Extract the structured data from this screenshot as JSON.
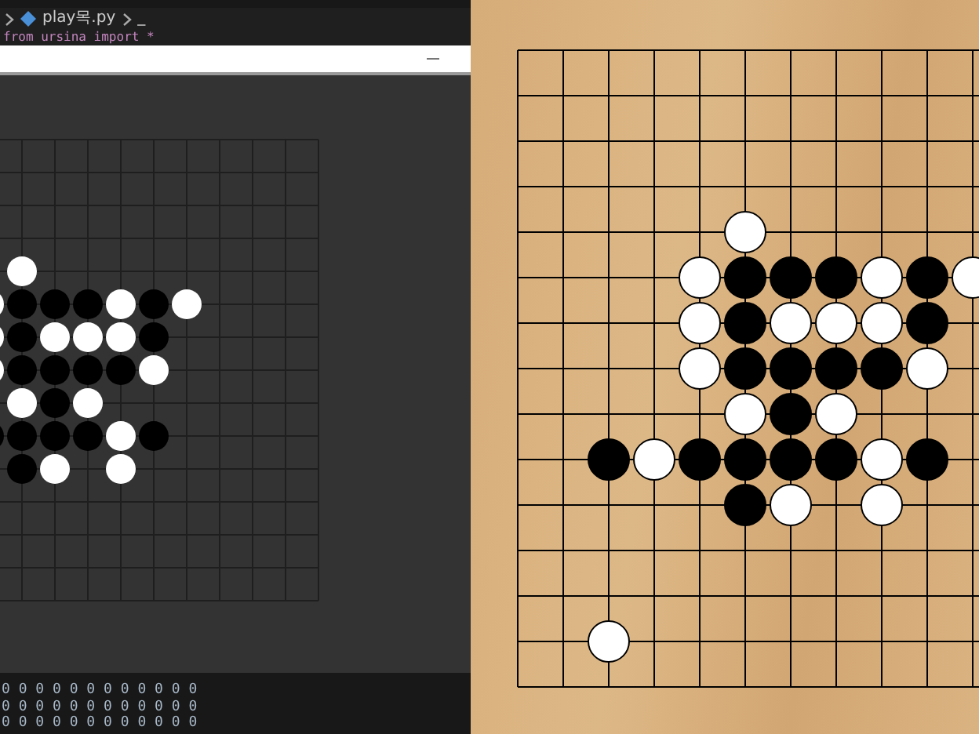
{
  "editor": {
    "file": "play목.py",
    "symbol": "_",
    "code_line": "from ursina import *"
  },
  "board": {
    "rows": [
      [
        {
          "kind": "empty"
        },
        {
          "kind": "empty"
        },
        {
          "kind": "empty"
        },
        {
          "kind": "empty"
        },
        {
          "kind": "empty"
        },
        {
          "kind": "empty"
        },
        {
          "kind": "empty"
        },
        {
          "kind": "empty"
        },
        {
          "kind": "empty"
        },
        {
          "kind": "empty"
        },
        {
          "kind": "empty"
        },
        {
          "kind": "empty"
        },
        {
          "kind": "empty"
        },
        {
          "kind": "empty"
        },
        {
          "kind": "empty"
        }
      ],
      [
        {
          "kind": "empty"
        },
        {
          "kind": "empty"
        },
        {
          "kind": "empty"
        },
        {
          "kind": "empty"
        },
        {
          "kind": "empty"
        },
        {
          "kind": "empty"
        },
        {
          "kind": "empty"
        },
        {
          "kind": "empty"
        },
        {
          "kind": "empty"
        },
        {
          "kind": "empty"
        },
        {
          "kind": "empty"
        },
        {
          "kind": "empty"
        },
        {
          "kind": "empty"
        },
        {
          "kind": "empty"
        },
        {
          "kind": "empty"
        }
      ],
      [
        {
          "kind": "empty"
        },
        {
          "kind": "empty"
        },
        {
          "kind": "empty"
        },
        {
          "kind": "empty"
        },
        {
          "kind": "empty"
        },
        {
          "kind": "empty"
        },
        {
          "kind": "empty"
        },
        {
          "kind": "empty"
        },
        {
          "kind": "empty"
        },
        {
          "kind": "empty"
        },
        {
          "kind": "empty"
        },
        {
          "kind": "empty"
        },
        {
          "kind": "empty"
        },
        {
          "kind": "empty"
        },
        {
          "kind": "empty"
        }
      ],
      [
        {
          "kind": "empty"
        },
        {
          "kind": "empty"
        },
        {
          "kind": "empty"
        },
        {
          "kind": "empty"
        },
        {
          "kind": "empty"
        },
        {
          "kind": "empty"
        },
        {
          "kind": "empty"
        },
        {
          "kind": "empty"
        },
        {
          "kind": "empty"
        },
        {
          "kind": "empty"
        },
        {
          "kind": "empty"
        },
        {
          "kind": "empty"
        },
        {
          "kind": "empty"
        },
        {
          "kind": "empty"
        },
        {
          "kind": "empty"
        }
      ],
      [
        {
          "kind": "empty"
        },
        {
          "kind": "empty"
        },
        {
          "kind": "empty"
        },
        {
          "kind": "empty"
        },
        {
          "kind": "empty"
        },
        {
          "kind": "white"
        },
        {
          "kind": "empty"
        },
        {
          "kind": "empty"
        },
        {
          "kind": "empty"
        },
        {
          "kind": "empty"
        },
        {
          "kind": "empty"
        },
        {
          "kind": "empty"
        },
        {
          "kind": "empty"
        },
        {
          "kind": "empty"
        },
        {
          "kind": "empty"
        }
      ],
      [
        {
          "kind": "empty"
        },
        {
          "kind": "empty"
        },
        {
          "kind": "empty"
        },
        {
          "kind": "empty"
        },
        {
          "kind": "white"
        },
        {
          "kind": "black"
        },
        {
          "kind": "black"
        },
        {
          "kind": "black"
        },
        {
          "kind": "white"
        },
        {
          "kind": "black"
        },
        {
          "kind": "white"
        },
        {
          "kind": "empty"
        },
        {
          "kind": "empty"
        },
        {
          "kind": "empty"
        },
        {
          "kind": "empty"
        }
      ],
      [
        {
          "kind": "empty"
        },
        {
          "kind": "empty"
        },
        {
          "kind": "empty"
        },
        {
          "kind": "empty"
        },
        {
          "kind": "white"
        },
        {
          "kind": "black"
        },
        {
          "kind": "white"
        },
        {
          "kind": "white"
        },
        {
          "kind": "white"
        },
        {
          "kind": "black"
        },
        {
          "kind": "empty"
        },
        {
          "kind": "empty"
        },
        {
          "kind": "empty"
        },
        {
          "kind": "empty"
        },
        {
          "kind": "empty"
        }
      ],
      [
        {
          "kind": "empty"
        },
        {
          "kind": "empty"
        },
        {
          "kind": "empty"
        },
        {
          "kind": "empty"
        },
        {
          "kind": "white"
        },
        {
          "kind": "black"
        },
        {
          "kind": "black"
        },
        {
          "kind": "black"
        },
        {
          "kind": "black"
        },
        {
          "kind": "white"
        },
        {
          "kind": "empty"
        },
        {
          "kind": "empty"
        },
        {
          "kind": "empty"
        },
        {
          "kind": "empty"
        },
        {
          "kind": "empty"
        }
      ],
      [
        {
          "kind": "empty"
        },
        {
          "kind": "empty"
        },
        {
          "kind": "empty"
        },
        {
          "kind": "empty"
        },
        {
          "kind": "empty"
        },
        {
          "kind": "white"
        },
        {
          "kind": "black"
        },
        {
          "kind": "white"
        },
        {
          "kind": "empty"
        },
        {
          "kind": "empty"
        },
        {
          "kind": "empty"
        },
        {
          "kind": "empty"
        },
        {
          "kind": "empty"
        },
        {
          "kind": "empty"
        },
        {
          "kind": "empty"
        }
      ],
      [
        {
          "kind": "empty"
        },
        {
          "kind": "empty"
        },
        {
          "kind": "black"
        },
        {
          "kind": "white"
        },
        {
          "kind": "black"
        },
        {
          "kind": "black"
        },
        {
          "kind": "black"
        },
        {
          "kind": "black"
        },
        {
          "kind": "white"
        },
        {
          "kind": "black"
        },
        {
          "kind": "empty"
        },
        {
          "kind": "empty"
        },
        {
          "kind": "empty"
        },
        {
          "kind": "empty"
        },
        {
          "kind": "empty"
        }
      ],
      [
        {
          "kind": "empty"
        },
        {
          "kind": "empty"
        },
        {
          "kind": "empty"
        },
        {
          "kind": "empty"
        },
        {
          "kind": "empty"
        },
        {
          "kind": "black"
        },
        {
          "kind": "white"
        },
        {
          "kind": "empty"
        },
        {
          "kind": "white"
        },
        {
          "kind": "empty"
        },
        {
          "kind": "empty"
        },
        {
          "kind": "empty"
        },
        {
          "kind": "empty"
        },
        {
          "kind": "empty"
        },
        {
          "kind": "empty"
        }
      ],
      [
        {
          "kind": "empty"
        },
        {
          "kind": "empty"
        },
        {
          "kind": "empty"
        },
        {
          "kind": "empty"
        },
        {
          "kind": "empty"
        },
        {
          "kind": "empty"
        },
        {
          "kind": "empty"
        },
        {
          "kind": "empty"
        },
        {
          "kind": "empty"
        },
        {
          "kind": "empty"
        },
        {
          "kind": "empty"
        },
        {
          "kind": "empty"
        },
        {
          "kind": "empty"
        },
        {
          "kind": "empty"
        },
        {
          "kind": "empty"
        }
      ],
      [
        {
          "kind": "empty"
        },
        {
          "kind": "empty"
        },
        {
          "kind": "empty"
        },
        {
          "kind": "empty"
        },
        {
          "kind": "empty"
        },
        {
          "kind": "empty"
        },
        {
          "kind": "empty"
        },
        {
          "kind": "empty"
        },
        {
          "kind": "empty"
        },
        {
          "kind": "empty"
        },
        {
          "kind": "empty"
        },
        {
          "kind": "empty"
        },
        {
          "kind": "empty"
        },
        {
          "kind": "empty"
        },
        {
          "kind": "empty"
        }
      ],
      [
        {
          "kind": "empty"
        },
        {
          "kind": "empty"
        },
        {
          "kind": "white"
        },
        {
          "kind": "empty"
        },
        {
          "kind": "empty"
        },
        {
          "kind": "empty"
        },
        {
          "kind": "empty"
        },
        {
          "kind": "empty"
        },
        {
          "kind": "empty"
        },
        {
          "kind": "empty"
        },
        {
          "kind": "empty"
        },
        {
          "kind": "empty"
        },
        {
          "kind": "empty"
        },
        {
          "kind": "empty"
        },
        {
          "kind": "empty"
        }
      ],
      [
        {
          "kind": "empty"
        },
        {
          "kind": "empty"
        },
        {
          "kind": "empty"
        },
        {
          "kind": "empty"
        },
        {
          "kind": "empty"
        },
        {
          "kind": "empty"
        },
        {
          "kind": "empty"
        },
        {
          "kind": "empty"
        },
        {
          "kind": "empty"
        },
        {
          "kind": "empty"
        },
        {
          "kind": "empty"
        },
        {
          "kind": "empty"
        },
        {
          "kind": "empty"
        },
        {
          "kind": "empty"
        },
        {
          "kind": "empty"
        }
      ]
    ]
  },
  "terminal": {
    "lines": [
      "0 0 0 0 0 0 0 0 0 0 0 0",
      "0 0 0 0 0 0 0 0 0 0 0 0",
      "0 0 0 0 0 0 0 0 0 0 0 0"
    ]
  }
}
